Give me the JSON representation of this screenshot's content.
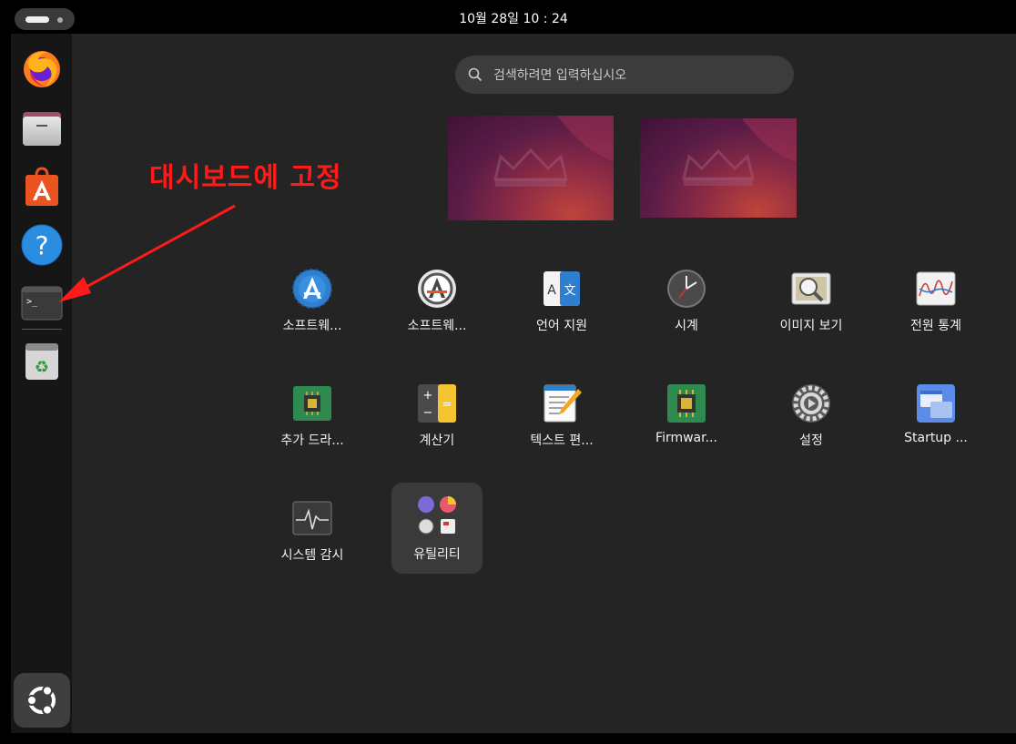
{
  "topbar": {
    "clock": "10월 28일  10 : 24"
  },
  "dock": {
    "items": [
      {
        "name": "Firefox",
        "icon": "firefox-icon"
      },
      {
        "name": "Files",
        "icon": "files-icon"
      },
      {
        "name": "App Center",
        "icon": "app-center-icon"
      },
      {
        "name": "Help",
        "icon": "help-icon"
      },
      {
        "name": "Terminal",
        "icon": "terminal-icon"
      },
      {
        "name": "Trash",
        "icon": "trash-icon"
      }
    ],
    "show_apps_icon": "ubuntu-logo-icon"
  },
  "search": {
    "placeholder": "검색하려면 입력하십시오"
  },
  "apps": [
    {
      "label": "소프트웨...",
      "icon": "software-icon"
    },
    {
      "label": "소프트웨...",
      "icon": "software-updater-icon"
    },
    {
      "label": "언어 지원",
      "icon": "language-icon"
    },
    {
      "label": "시계",
      "icon": "clock-icon"
    },
    {
      "label": "이미지 보기",
      "icon": "image-viewer-icon"
    },
    {
      "label": "전원 통계",
      "icon": "power-stats-icon"
    },
    {
      "label": "추가 드라...",
      "icon": "chip-icon"
    },
    {
      "label": "계산기",
      "icon": "calculator-icon"
    },
    {
      "label": "텍스트 편...",
      "icon": "text-editor-icon"
    },
    {
      "label": "Firmwar...",
      "icon": "firmware-icon"
    },
    {
      "label": "설정",
      "icon": "settings-icon"
    },
    {
      "label": "Startup ...",
      "icon": "startup-disk-icon"
    },
    {
      "label": "시스템 감시",
      "icon": "system-monitor-icon"
    },
    {
      "label": "유틸리티",
      "icon": "utilities-folder-icon"
    }
  ],
  "annotation": {
    "text": "대시보드에 고정",
    "color": "#ff1a1a"
  },
  "colors": {
    "background": "#242424",
    "dock": "#161616",
    "accent": "#e95420"
  }
}
